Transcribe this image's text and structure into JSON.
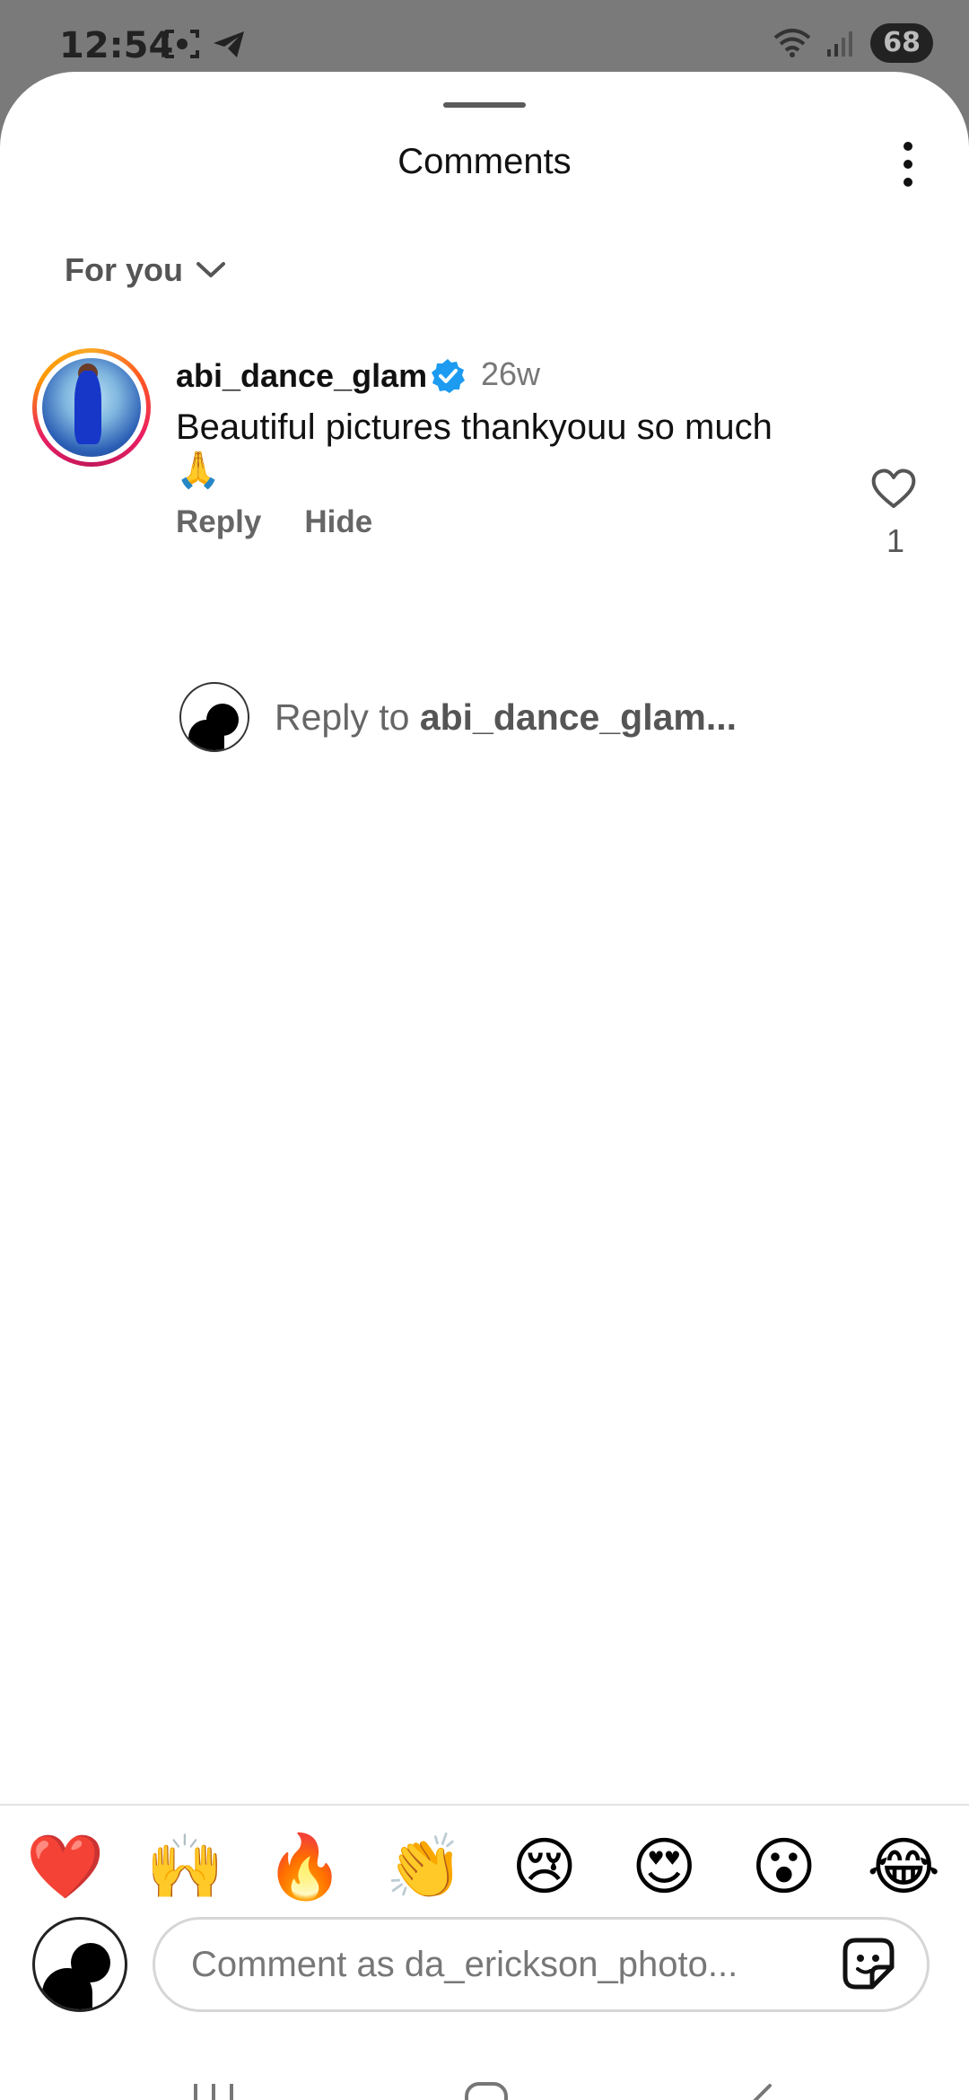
{
  "status_bar": {
    "time": "12:54",
    "battery": "68"
  },
  "sheet": {
    "title": "Comments"
  },
  "sort": {
    "label": "For you"
  },
  "comment": {
    "username": "abi_dance_glam",
    "age": "26w",
    "text": "Beautiful pictures thankyouu so much 🙏",
    "reply_label": "Reply",
    "hide_label": "Hide",
    "like_count": "1"
  },
  "reply_prompt": {
    "prefix": "Reply to ",
    "target": "abi_dance_glam..."
  },
  "emoji_bar": [
    "❤️",
    "🙌",
    "🔥",
    "👏",
    "😢",
    "😍",
    "😮",
    "😂"
  ],
  "composer": {
    "placeholder": "Comment as da_erickson_photo..."
  },
  "colors": {
    "verified": "#1d9bf0",
    "ring_start": "#f9a825",
    "ring_end": "#e91e63"
  }
}
